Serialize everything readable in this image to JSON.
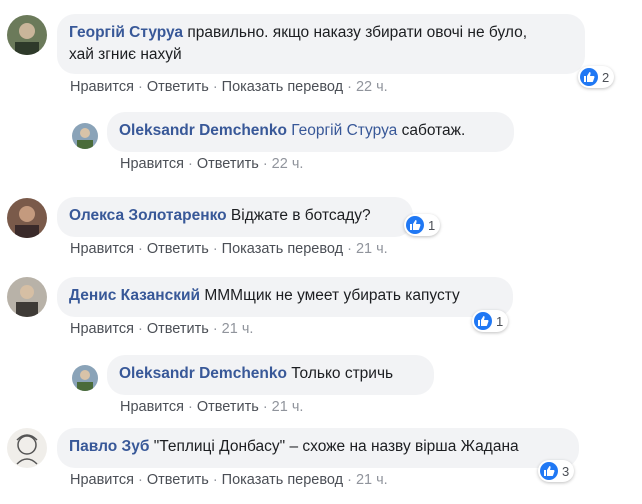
{
  "colors": {
    "link": "#385898",
    "bubble": "#f2f3f5",
    "like": "#2078f4",
    "meta": "#90949c"
  },
  "actions": {
    "like": "Нравится",
    "reply": "Ответить",
    "translate": "Показать перевод"
  },
  "comments": [
    {
      "author": "Георгій Стуруа",
      "text_line1": "правильно. якщо наказу збирати овочі не було,",
      "text_line2": "хай згниє нахуй",
      "time": "22 ч.",
      "reactions": "2",
      "avatar_icon": "user-avatar-icon"
    },
    {
      "author": "Oleksandr Demchenko",
      "mention": "Георгій Стуруа",
      "text": "саботаж.",
      "time": "22 ч.",
      "avatar_icon": "user-avatar-icon"
    },
    {
      "author": "Олекса Золотаренко",
      "text": "Віджате в ботсаду?",
      "time": "21 ч.",
      "reactions": "1",
      "avatar_icon": "user-avatar-icon"
    },
    {
      "author": "Денис Казанский",
      "text": "МММщик не умеет убирать капусту",
      "time": "21 ч.",
      "reactions": "1",
      "avatar_icon": "user-avatar-icon"
    },
    {
      "author": "Oleksandr Demchenko",
      "text": "Только стричь",
      "time": "21 ч.",
      "avatar_icon": "user-avatar-icon"
    },
    {
      "author": "Павло Зуб",
      "text": "\"Теплиці Донбасу\" – схоже на назву вірша Жадана",
      "time": "21 ч.",
      "reactions": "3",
      "avatar_icon": "user-avatar-icon"
    }
  ]
}
